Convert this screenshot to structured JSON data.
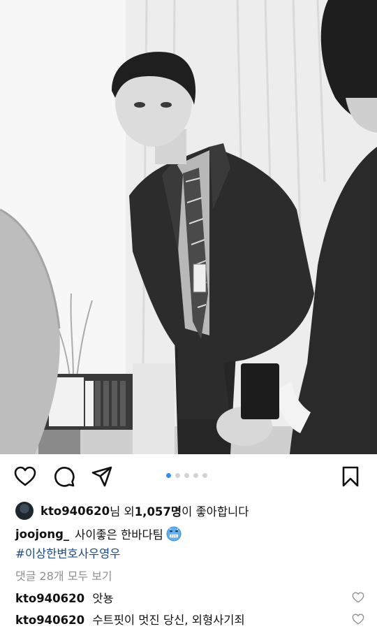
{
  "post": {
    "photo_alt": "",
    "carousel": {
      "count": 5,
      "active_index": 0
    }
  },
  "actions": {
    "like_icon": "heart-outline-icon",
    "comment_icon": "comment-bubble-icon",
    "share_icon": "paper-plane-icon",
    "save_icon": "bookmark-icon"
  },
  "likes": {
    "username": "kto940620",
    "text_mid": "님 외 ",
    "count": "1,057명",
    "text_end": "이 좋아합니다"
  },
  "caption": {
    "username": "joojong_",
    "text": "사이좋은 한바다팀",
    "emoji": "cold-face-emoji",
    "hashtag": "#이상한변호사우영우"
  },
  "view_comments": "댓글 28개 모두 보기",
  "comments": [
    {
      "username": "kto940620",
      "text": "앗뇽"
    },
    {
      "username": "kto940620",
      "text": "수트핏이 멋진 당신, 외형사기죄"
    }
  ],
  "colors": {
    "accent": "#2a94f4",
    "hashtag": "#1b4a8a",
    "muted": "#8e8e8e"
  }
}
